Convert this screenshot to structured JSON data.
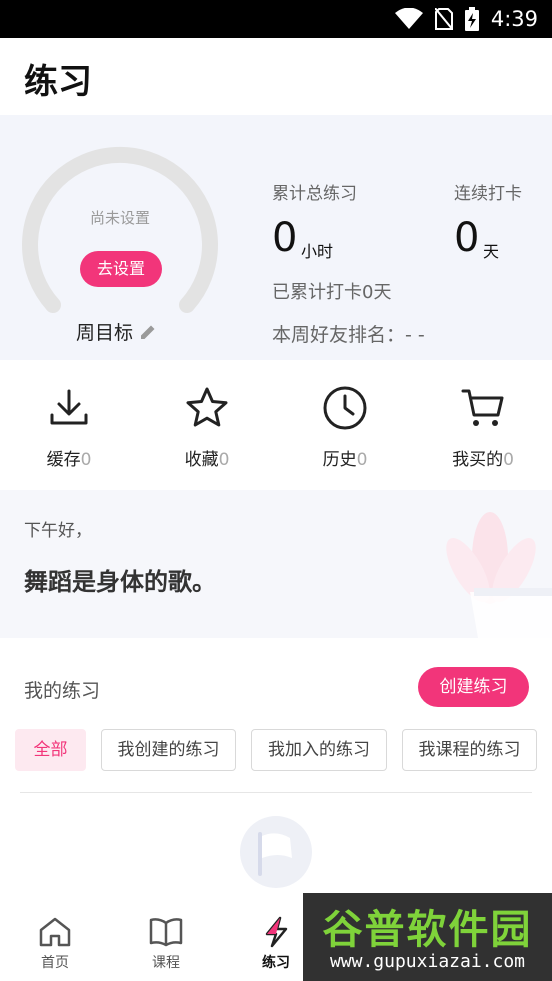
{
  "status_bar": {
    "time": "4:39",
    "icons": [
      "wifi-icon",
      "no-sim-icon",
      "battery-charging-icon"
    ]
  },
  "page": {
    "title": "练习"
  },
  "goal": {
    "status": "尚未设置",
    "set_button": "去设置",
    "label": "周目标",
    "edit_icon": "pencil-icon"
  },
  "stats": {
    "total_label": "累计总练习",
    "total_value": "0",
    "total_unit": "小时",
    "streak_label": "连续打卡",
    "streak_value": "0",
    "streak_unit": "天",
    "checkin_text": "已累计打卡0天",
    "ranking_text": "本周好友排名：- -"
  },
  "quick_actions": [
    {
      "label": "缓存",
      "count": "0",
      "icon": "download-icon"
    },
    {
      "label": "收藏",
      "count": "0",
      "icon": "star-icon"
    },
    {
      "label": "历史",
      "count": "0",
      "icon": "clock-icon"
    },
    {
      "label": "我买的",
      "count": "0",
      "icon": "cart-icon"
    }
  ],
  "greeting": {
    "small": "下午好，",
    "big": "舞蹈是身体的歌。"
  },
  "my_practice": {
    "title": "我的练习",
    "create_button": "创建练习",
    "filters": [
      "全部",
      "我创建的练习",
      "我加入的练习",
      "我课程的练习"
    ],
    "active_filter": "全部"
  },
  "tabbar": {
    "tabs": [
      {
        "label": "首页",
        "icon": "home-icon"
      },
      {
        "label": "课程",
        "icon": "book-icon"
      },
      {
        "label": "练习",
        "icon": "lightning-icon",
        "active": true
      }
    ]
  },
  "watermark": {
    "big": "谷普软件园",
    "small": "www.gupuxiazai.com"
  },
  "colors": {
    "accent": "#f2357a",
    "card_bg": "#f3f5fb",
    "gauge": "#e3e3e3"
  }
}
